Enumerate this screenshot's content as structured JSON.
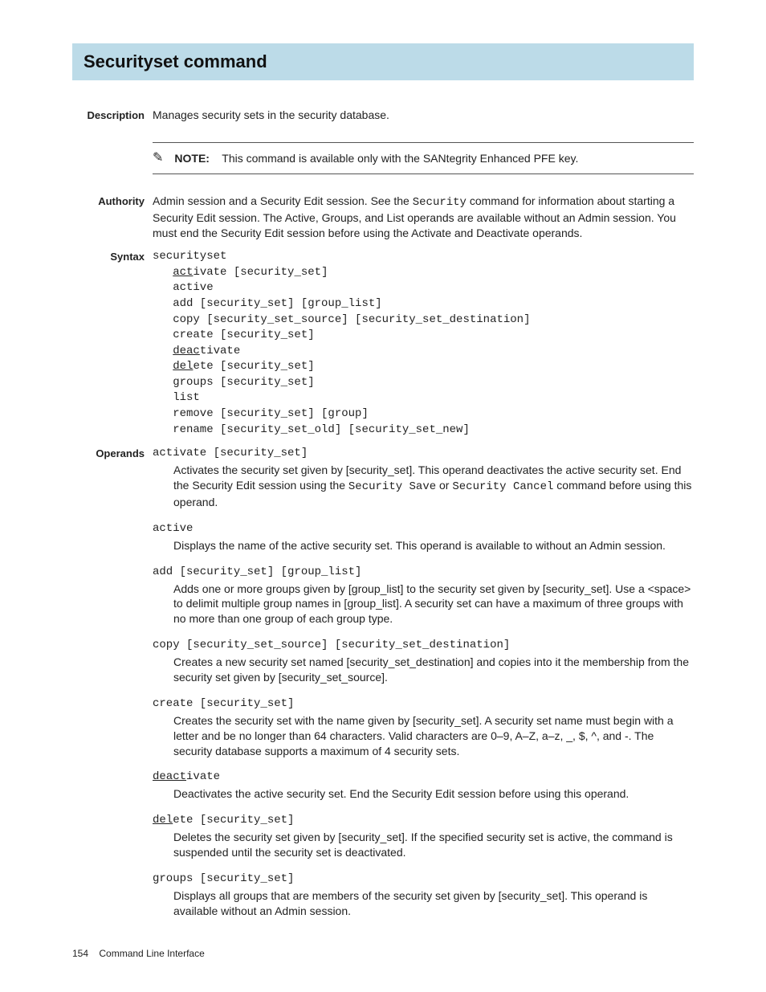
{
  "title": "Securityset command",
  "description": {
    "label": "Description",
    "text": "Manages security sets in the security database."
  },
  "note": {
    "prefix": "NOTE:",
    "text": "This command is available only with the SANtegrity Enhanced PFE key."
  },
  "authority": {
    "label": "Authority",
    "text_pre": "Admin session and a Security Edit session. See the ",
    "code1": "Security",
    "text_post": " command for information about starting a Security Edit session. The Active, Groups, and List operands are available without an Admin session. You must end the Security Edit session before using the Activate and Deactivate operands."
  },
  "syntax": {
    "label": "Syntax",
    "cmd": "securityset",
    "lines": [
      {
        "pre": "act",
        "rest": "ivate [security_set]"
      },
      {
        "pre": "",
        "rest": "active"
      },
      {
        "pre": "",
        "rest": "add [security_set] [group_list]"
      },
      {
        "pre": "",
        "rest": "copy [security_set_source] [security_set_destination]"
      },
      {
        "pre": "",
        "rest": "create [security_set]"
      },
      {
        "pre": "deac",
        "rest": "tivate"
      },
      {
        "pre": "del",
        "rest": "ete [security_set]"
      },
      {
        "pre": "",
        "rest": "groups [security_set]"
      },
      {
        "pre": "",
        "rest": "list"
      },
      {
        "pre": "",
        "rest": "remove [security_set] [group]"
      },
      {
        "pre": "",
        "rest": "rename [security_set_old] [security_set_new]"
      }
    ]
  },
  "operands": {
    "label": "Operands",
    "items": [
      {
        "head": "activate [security_set]",
        "body_pre": "Activates the security set given by [security_set]. This operand deactivates the active security set. End the Security Edit session using the ",
        "code1": "Security Save",
        "mid1": " or ",
        "code2": "Security Cancel",
        "body_post": " command before using this operand."
      },
      {
        "head": "active",
        "body": "Displays the name of the active security set. This operand is available to without an Admin session."
      },
      {
        "head": "add [security_set] [group_list]",
        "body": "Adds one or more groups given by [group_list] to the security set given by [security_set]. Use a <space> to delimit multiple group names in [group_list]. A security set can have a maximum of three groups with no more than one group of each group type."
      },
      {
        "head": "copy [security_set_source] [security_set_destination]",
        "body": "Creates a new security set named [security_set_destination] and copies into it the membership from the security set given by [security_set_source]."
      },
      {
        "head": "create [security_set]",
        "body": "Creates the security set with the name given by [security_set]. A security set name must begin with a letter and be no longer than 64 characters. Valid characters are 0–9, A–Z, a–z, _, $, ^, and -. The security database supports a maximum of 4 security sets."
      },
      {
        "head_ul": "deact",
        "head_rest": "ivate",
        "body": "Deactivates the active security set. End the Security Edit session before using this operand."
      },
      {
        "head_ul": "del",
        "head_rest": "ete [security_set]",
        "body": "Deletes the security set given by [security_set]. If the specified security set is active, the command is suspended until the security set is deactivated."
      },
      {
        "head": "groups [security_set]",
        "body": "Displays all groups that are members of the security set given by [security_set]. This operand is available without an Admin session."
      }
    ]
  },
  "footer": {
    "page": "154",
    "title": "Command Line Interface"
  }
}
